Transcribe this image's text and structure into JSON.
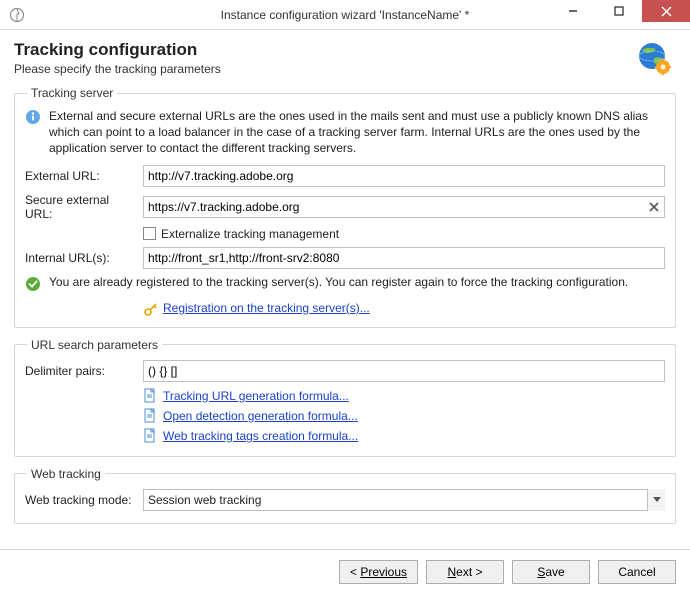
{
  "window": {
    "title": "Instance configuration wizard 'InstanceName' *"
  },
  "header": {
    "title": "Tracking configuration",
    "subtitle": "Please specify the tracking parameters"
  },
  "tracking_server": {
    "legend": "Tracking server",
    "info": "External and secure external URLs are the ones used in the mails sent and must use a publicly known DNS alias which can point to a load balancer in the case of a tracking server farm. Internal URLs are the ones used by the application server to contact the different tracking servers.",
    "external_label": "External URL:",
    "external_value": "http://v7.tracking.adobe.org",
    "secure_label": "Secure external URL:",
    "secure_value": "https://v7.tracking.adobe.org",
    "externalize_label": "Externalize tracking management",
    "internal_label": "Internal URL(s):",
    "internal_value": "http://front_sr1,http://front-srv2:8080",
    "status": "You are already registered to the tracking server(s). You can register again to force the tracking configuration.",
    "register_link": "Registration on the tracking server(s)..."
  },
  "url_params": {
    "legend": "URL search parameters",
    "delimiter_label": "Delimiter pairs:",
    "delimiter_value": "() {} []",
    "link_url_formula": "Tracking URL generation formula...",
    "link_open_formula": "Open detection generation formula...",
    "link_web_tags": "Web tracking tags creation formula..."
  },
  "web_tracking": {
    "legend": "Web tracking",
    "mode_label": "Web tracking mode:",
    "mode_value": "Session web tracking"
  },
  "footer": {
    "previous": "Previous",
    "next": "Next >",
    "save": "Save",
    "cancel": "Cancel"
  }
}
